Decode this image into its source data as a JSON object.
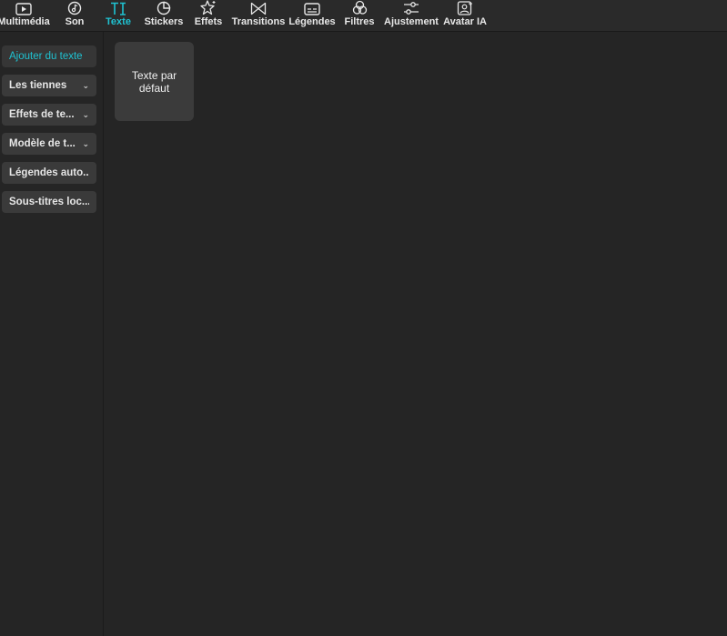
{
  "toolbar": {
    "tabs": [
      {
        "label": "Multimédia",
        "icon": "media-icon"
      },
      {
        "label": "Son",
        "icon": "music-icon"
      },
      {
        "label": "Texte",
        "icon": "text-icon",
        "active": true
      },
      {
        "label": "Stickers",
        "icon": "sticker-icon"
      },
      {
        "label": "Effets",
        "icon": "effects-icon"
      },
      {
        "label": "Transitions",
        "icon": "transition-icon"
      },
      {
        "label": "Légendes",
        "icon": "captions-icon"
      },
      {
        "label": "Filtres",
        "icon": "filters-icon"
      },
      {
        "label": "Ajustement",
        "icon": "adjust-icon"
      },
      {
        "label": "Avatar IA",
        "icon": "avatar-icon"
      }
    ],
    "accent_color": "#1fc2d1"
  },
  "sidebar": {
    "items": [
      {
        "label": "Ajouter du texte",
        "active": true
      },
      {
        "label": "Les tiennes",
        "chevron": true
      },
      {
        "label": "Effets de te...",
        "chevron": true
      },
      {
        "label": "Modèle de t...",
        "chevron": true
      },
      {
        "label": "Légendes auto..."
      },
      {
        "label": "Sous-titres loc..."
      }
    ]
  },
  "content": {
    "card_label": "Texte par défaut"
  }
}
